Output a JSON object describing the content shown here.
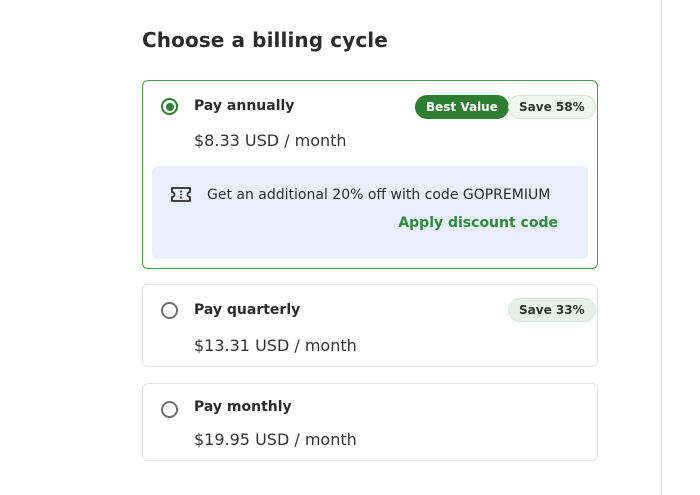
{
  "page": {
    "title": "Choose a billing cycle"
  },
  "plans": [
    {
      "label": "Pay annually",
      "price": "$8.33 USD / month",
      "selected": true,
      "best_badge": "Best Value",
      "save_badge": "Save 58%",
      "promo": {
        "text": "Get an additional 20% off with code GOPREMIUM",
        "link": "Apply discount code",
        "icon": "ticket-icon"
      }
    },
    {
      "label": "Pay quarterly",
      "price": "$13.31 USD / month",
      "selected": false,
      "save_badge": "Save 33%"
    },
    {
      "label": "Pay monthly",
      "price": "$19.95 USD / month",
      "selected": false
    }
  ],
  "colors": {
    "accent": "#2e7d32",
    "selected_border": "#4c9e4c",
    "promo_bg": "#e8eefb",
    "link": "#2e8b3a"
  }
}
